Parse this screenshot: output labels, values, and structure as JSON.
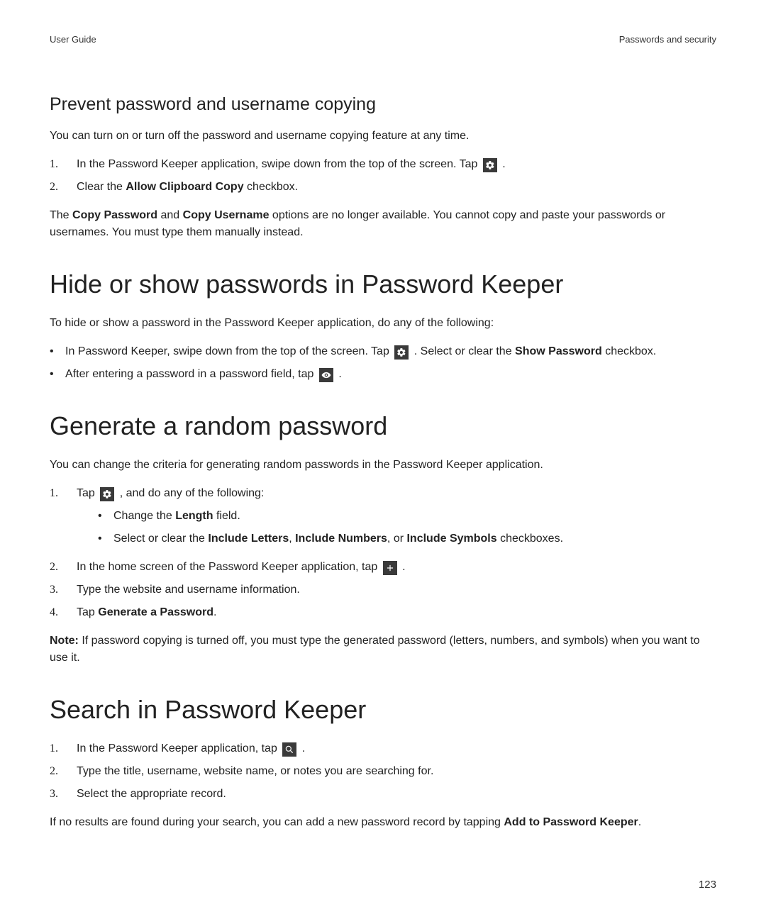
{
  "header": {
    "left": "User Guide",
    "right": "Passwords and security"
  },
  "s1": {
    "title": "Prevent password and username copying",
    "intro": "You can turn on or turn off the password and username copying feature at any time.",
    "steps": {
      "n1": "1.",
      "t1a": "In the Password Keeper application, swipe down from the top of the screen. Tap ",
      "t1b": " .",
      "n2": "2.",
      "t2a": "Clear the ",
      "t2b": "Allow Clipboard Copy",
      "t2c": " checkbox."
    },
    "para": {
      "a": "The ",
      "b": "Copy Password",
      "c": " and ",
      "d": "Copy Username",
      "e": " options are no longer available. You cannot copy and paste your passwords or usernames. You must type them manually instead."
    }
  },
  "s2": {
    "title": "Hide or show passwords in Password Keeper",
    "intro": "To hide or show a password in the Password Keeper application, do any of the following:",
    "b1": {
      "a": "In Password Keeper, swipe down from the top of the screen. Tap ",
      "b": " . Select or clear the ",
      "c": "Show Password",
      "d": " checkbox."
    },
    "b2": {
      "a": "After entering a password in a password field, tap ",
      "b": " ."
    }
  },
  "s3": {
    "title": "Generate a random password",
    "intro": "You can change the criteria for generating random passwords in the Password Keeper application.",
    "n1": "1.",
    "s1": {
      "a": "Tap ",
      "b": " , and do any of the following:"
    },
    "sub1": {
      "a": "Change the ",
      "b": "Length",
      "c": " field."
    },
    "sub2": {
      "a": "Select or clear the ",
      "b": "Include Letters",
      "c": ", ",
      "d": "Include Numbers",
      "e": ", or ",
      "f": "Include Symbols",
      "g": " checkboxes."
    },
    "n2": "2.",
    "s2": {
      "a": "In the home screen of the Password Keeper application, tap ",
      "b": " ."
    },
    "n3": "3.",
    "s3txt": "Type the website and username information.",
    "n4": "4.",
    "s4": {
      "a": "Tap ",
      "b": "Generate a Password",
      "c": "."
    },
    "note": {
      "a": "Note:",
      "b": " If password copying is turned off, you must type the generated password (letters, numbers, and symbols) when you want to use it."
    }
  },
  "s4": {
    "title": "Search in Password Keeper",
    "n1": "1.",
    "s1": {
      "a": "In the Password Keeper application, tap ",
      "b": " ."
    },
    "n2": "2.",
    "s2txt": "Type the title, username, website name, or notes you are searching for.",
    "n3": "3.",
    "s3txt": "Select the appropriate record.",
    "para": {
      "a": "If no results are found during your search, you can add a new password record by tapping ",
      "b": "Add to Password Keeper",
      "c": "."
    }
  },
  "page_number": "123"
}
